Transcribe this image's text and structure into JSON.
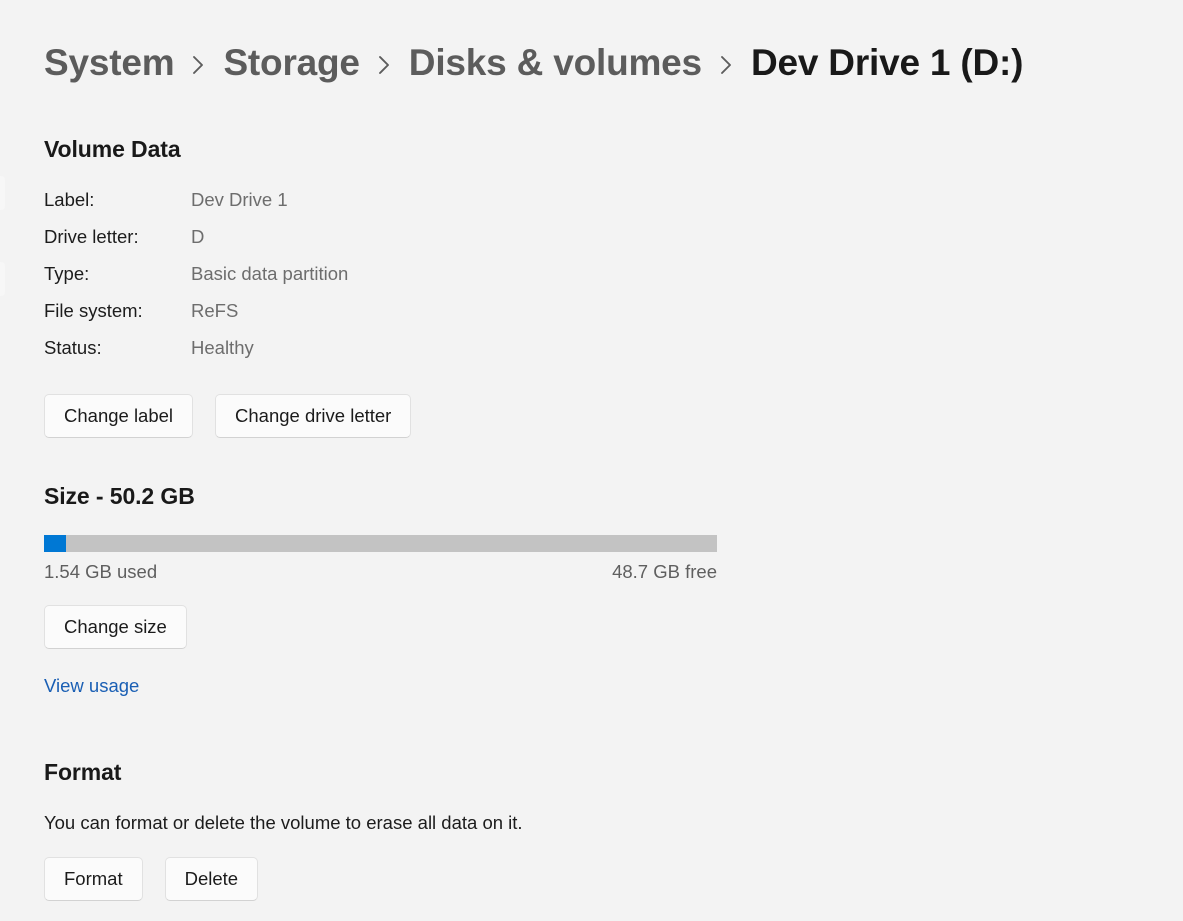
{
  "breadcrumb": {
    "separator_icon": "chevron-right-icon",
    "items": [
      {
        "label": "System",
        "current": false
      },
      {
        "label": "Storage",
        "current": false
      },
      {
        "label": "Disks & volumes",
        "current": false
      },
      {
        "label": "Dev Drive 1 (D:)",
        "current": true
      }
    ]
  },
  "volume_data": {
    "title": "Volume Data",
    "rows": [
      {
        "key": "Label:",
        "value": "Dev Drive 1"
      },
      {
        "key": "Drive letter:",
        "value": "D"
      },
      {
        "key": "Type:",
        "value": "Basic data partition"
      },
      {
        "key": "File system:",
        "value": "ReFS"
      },
      {
        "key": "Status:",
        "value": "Healthy"
      }
    ],
    "change_label_button": "Change label",
    "change_drive_letter_button": "Change drive letter"
  },
  "size": {
    "title": "Size - 50.2 GB",
    "total": "50.2 GB",
    "used_label": "1.54 GB used",
    "free_label": "48.7 GB free",
    "used_percent": 3.3,
    "fill_color": "#0078d4",
    "track_color": "#c3c3c3",
    "change_size_button": "Change size",
    "view_usage_link": "View usage"
  },
  "format": {
    "title": "Format",
    "description": "You can format or delete the volume to erase all data on it.",
    "format_button": "Format",
    "delete_button": "Delete"
  }
}
